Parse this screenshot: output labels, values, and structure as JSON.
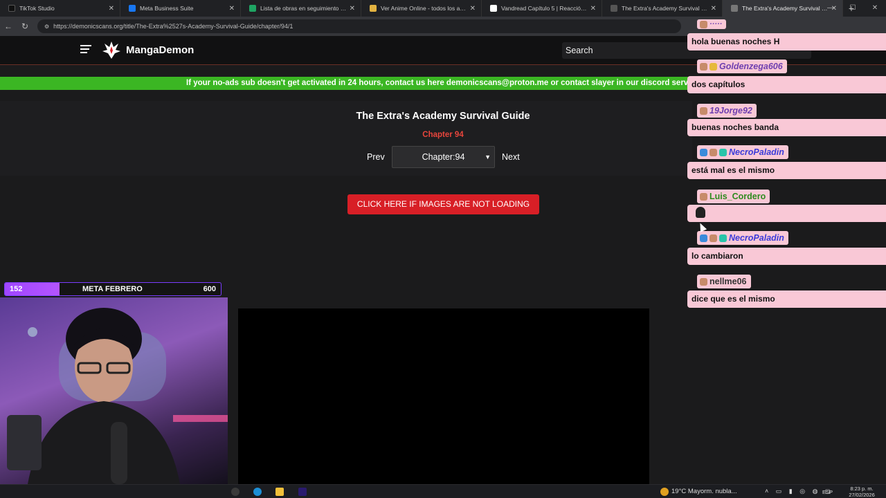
{
  "browser": {
    "tabs": [
      {
        "title": "TikTok Studio",
        "favicon": "tiktok-icon",
        "color": "#111111"
      },
      {
        "title": "Meta Business Suite",
        "favicon": "meta-icon",
        "color": "#1877f2"
      },
      {
        "title": "Lista de obras en seguimiento - H",
        "favicon": "sheets-icon",
        "color": "#1fa463"
      },
      {
        "title": "Ver Anime Online - todos los anim",
        "favicon": "anime-site-icon",
        "color": "#e3b341"
      },
      {
        "title": "Vandread Capítulo 5 | Reacción | F",
        "favicon": "notion-icon",
        "color": "#ffffff"
      },
      {
        "title": "The Extra's Academy Survival Gui",
        "favicon": "mangademon-icon",
        "color": "#888888"
      },
      {
        "title": "The Extra's Academy Survival Gui",
        "favicon": "mangademon-icon",
        "color": "#888888",
        "active": true
      }
    ],
    "url": "https://demonicscans.org/title/The-Extra%2527s-Academy-Survival-Guide/chapter/94/1"
  },
  "site": {
    "brand": "MangaDemon",
    "search_label": "Search",
    "announcement": "If your no-ads sub doesn't get activated in 24 hours, contact us here demonicscans@proton.me or contact slayer in our discord server",
    "series_title": "The Extra's Academy Survival Guide",
    "chapter_label": "Chapter 94",
    "prev_label": "Prev",
    "next_label": "Next",
    "chapter_select_value": "Chapter:94",
    "reload_button": "CLICK HERE IF IMAGES ARE NOT LOADING"
  },
  "stream_goal": {
    "current": "152",
    "title": "META FEBRERO",
    "target": "600",
    "progress": 0.253,
    "color": "#a046ff"
  },
  "chat": {
    "partial_message": "hola buenas noches H",
    "messages": [
      {
        "user": "Goldenzega606",
        "text": "dos capítulos"
      },
      {
        "user": "19Jorge92",
        "text": "buenas noches banda"
      },
      {
        "user": "NecroPaladin",
        "text": "está mal es el mismo"
      },
      {
        "user": "Luis_Cordero",
        "text": ""
      },
      {
        "user": "NecroPaladin",
        "text": "lo cambiaron"
      },
      {
        "user": "nellme06",
        "text": "dice que es el mismo"
      }
    ]
  },
  "taskbar": {
    "weather": "19°C  Mayorm. nubla...",
    "language": "ESP",
    "time": "8:23 p. m.",
    "date": "27/02/2026"
  }
}
